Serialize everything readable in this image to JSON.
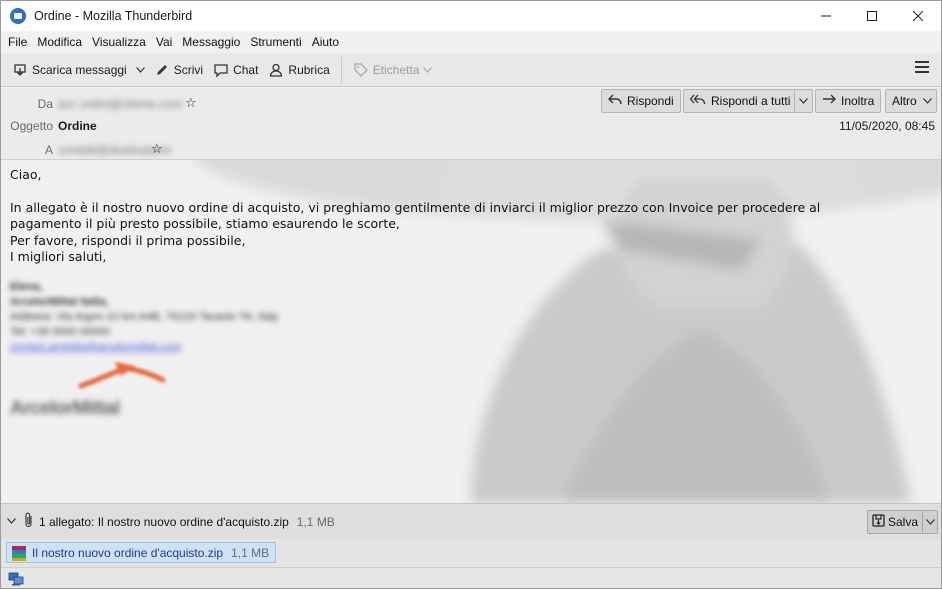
{
  "window": {
    "title": "Ordine - Mozilla Thunderbird",
    "controls": {
      "minimize": "—",
      "maximize": "☐",
      "close": "✕"
    }
  },
  "menubar": {
    "items": [
      "File",
      "Modifica",
      "Visualizza",
      "Vai",
      "Messaggio",
      "Strumenti",
      "Aiuto"
    ]
  },
  "toolbar": {
    "get_messages": "Scarica messaggi",
    "write": "Scrivi",
    "chat": "Chat",
    "address_book": "Rubrica",
    "tag": "Etichetta"
  },
  "header": {
    "from_label": "Da",
    "from_value": "acc ordini@cliente.com",
    "subject_label": "Oggetto",
    "subject_value": "Ordine",
    "to_label": "A",
    "to_value": "contatti@destinatario",
    "reply": "Rispondi",
    "reply_all": "Rispondi a tutti",
    "forward": "Inoltra",
    "more": "Altro",
    "date": "11/05/2020, 08:45"
  },
  "body": {
    "greeting": "Ciao,",
    "paragraph_line1": "In allegato è il nostro nuovo ordine di acquisto, vi preghiamo gentilmente di inviarci il miglior prezzo con Invoice per procedere al",
    "paragraph_line2": "pagamento il più presto possibile, stiamo esaurendo le scorte,",
    "paragraph_line3": "Per favore, rispondi il prima possibile,",
    "paragraph_line4": "I migliori saluti,",
    "signature": {
      "name": "Elena,",
      "company": "ArcelorMittal Italia,",
      "address": "Address: Via Aspro 10 km A4B, 76123 Taranto TA, Italy",
      "phone": "Tel: +39 0000 00000",
      "email": "contact.amitalia@arcelormittal.com",
      "logo": "ArcelorMittal"
    }
  },
  "attachments": {
    "summary": "1 allegato: Il nostro nuovo ordine d'acquisto.zip",
    "total_size": "1,1 MB",
    "save": "Salva",
    "items": [
      {
        "name": "Il nostro nuovo ordine d'acquisto.zip",
        "size": "1,1 MB"
      }
    ]
  },
  "colors": {
    "accent_link": "#4f62e6",
    "attachment_selected_bg": "#cde2f7",
    "annotation_arrow": "#e8643c"
  }
}
